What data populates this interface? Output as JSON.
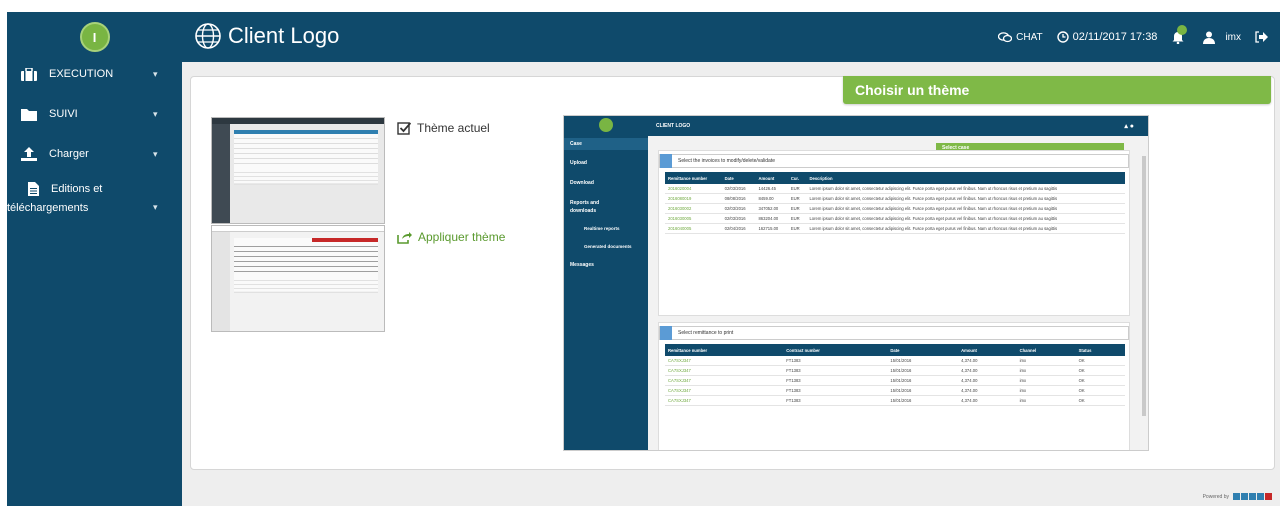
{
  "sidebar": {
    "avatar_letter": "I",
    "items": [
      {
        "label": "EXECUTION"
      },
      {
        "label": "SUIVI"
      },
      {
        "label": "Charger"
      },
      {
        "label_line1": "Editions et",
        "label_line2": "téléchargements"
      }
    ]
  },
  "header": {
    "brand": "Client Logo",
    "chat_label": "CHAT",
    "datetime": "02/11/2017 17:38",
    "notif_count": "2",
    "username": "imx"
  },
  "theme_panel": {
    "title": "Choisir un thème",
    "current_label": "Thème actuel",
    "apply_label": "Appliquer thème"
  },
  "preview": {
    "brand": "CLIENT LOGO",
    "avatar_letter": "I",
    "green_label": "Select case",
    "side_items": [
      "Case",
      "Upload",
      "Download",
      "Reports and",
      "downloads",
      "Realtime reports",
      "Generated documents",
      "Messages"
    ],
    "panel1_title": "Select the invoices to modify/delete/validate",
    "panel1_headers": [
      "Remittance number",
      "Date",
      "Amount",
      "Cur.",
      "Description"
    ],
    "panel1_rows": [
      [
        "2016020004",
        "02/03/2016",
        "14426.45",
        "EUR",
        "Lorem ipsum dolor sit amet, consectetur adipiscing elit. Fusce porta eget purus vel finibus. Nam ut rhoncus risus et pretium au sagittis"
      ],
      [
        "2016080019",
        "08/08/2016",
        "8459.00",
        "EUR",
        "Lorem ipsum dolor sit amet, consectetur adipiscing elit. Fusce porta eget purus vel finibus. Nam ut rhoncus risus et pretium au sagittis"
      ],
      [
        "2016030002",
        "02/03/2016",
        "347052.00",
        "EUR",
        "Lorem ipsum dolor sit amet, consectetur adipiscing elit. Fusce porta eget purus vel finibus. Nam ut rhoncus risus et pretium au sagittis"
      ],
      [
        "2016030005",
        "02/03/2016",
        "863204.00",
        "EUR",
        "Lorem ipsum dolor sit amet, consectetur adipiscing elit. Fusce porta eget purus vel finibus. Nam ut rhoncus risus et pretium au sagittis"
      ],
      [
        "2016040005",
        "02/04/2016",
        "162715.00",
        "EUR",
        "Lorem ipsum dolor sit amet, consectetur adipiscing elit. Fusce porta eget purus vel finibus. Nam ut rhoncus risus et pretium au sagittis"
      ]
    ],
    "panel2_title": "Select remittance to print",
    "panel2_headers": [
      "Remittance number",
      "Contract number",
      "Date",
      "Amount",
      "Channel",
      "Status"
    ],
    "panel2_rows": [
      [
        "CA7SXJ347",
        "FT1383",
        "15/01/2016",
        "4,374.00",
        "imx",
        "OK"
      ],
      [
        "CA7SXJ347",
        "FT1383",
        "15/01/2016",
        "4,374.00",
        "imx",
        "OK"
      ],
      [
        "CA7SXJ347",
        "FT1383",
        "15/01/2016",
        "4,374.00",
        "imx",
        "OK"
      ],
      [
        "CA7SXJ347",
        "FT1383",
        "15/01/2016",
        "4,374.00",
        "imx",
        "OK"
      ],
      [
        "CA7SXJ347",
        "FT1383",
        "15/01/2016",
        "4,374.00",
        "imx",
        "OK"
      ]
    ]
  },
  "footer": {
    "powered_by": "Powered by"
  },
  "colors": {
    "navy": "#0f4a6b",
    "green": "#7fb947",
    "accent_dark": "#2d3840"
  }
}
